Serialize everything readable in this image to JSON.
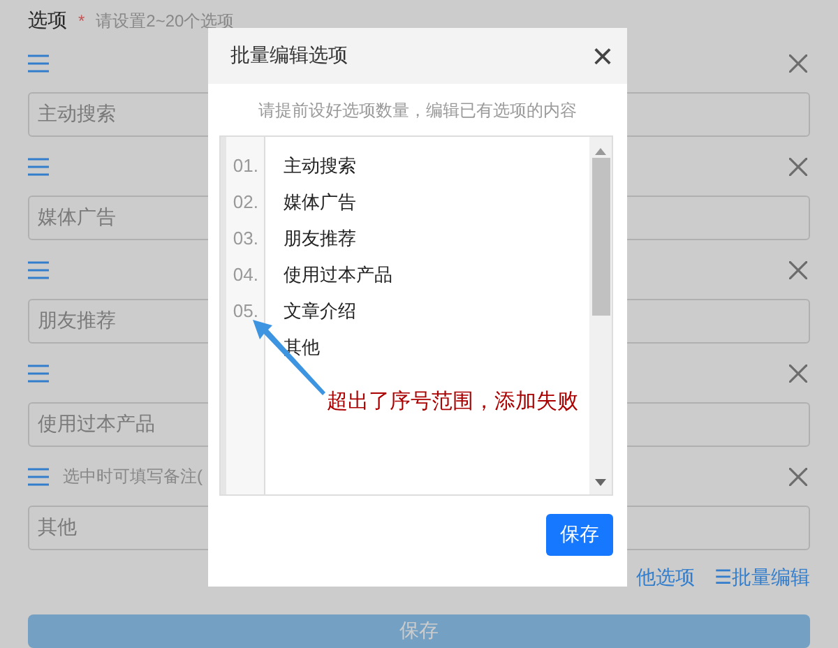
{
  "form": {
    "label": "选项",
    "required_mark": "*",
    "hint": "请设置2~20个选项",
    "options": [
      {
        "value": "主动搜索"
      },
      {
        "value": "媒体广告"
      },
      {
        "value": "朋友推荐"
      },
      {
        "value": "使用过本产品"
      },
      {
        "note_label": "选中时可填写备注(",
        "value": "其他"
      }
    ],
    "links": [
      "他选项",
      "☰批量编辑"
    ],
    "save_button": "保存"
  },
  "dialog": {
    "title": "批量编辑选项",
    "close": "×",
    "instruction": "请提前设好选项数量，编辑已有选项的内容",
    "lines": [
      {
        "number": "01.",
        "text": "主动搜索"
      },
      {
        "number": "02.",
        "text": "媒体广告"
      },
      {
        "number": "03.",
        "text": "朋友推荐"
      },
      {
        "number": "04.",
        "text": "使用过本产品"
      },
      {
        "number": "05.",
        "text": "文章介绍"
      },
      {
        "text": "其他"
      }
    ],
    "annotation": "超出了序号范围，添加失败",
    "save_button": "保存"
  }
}
